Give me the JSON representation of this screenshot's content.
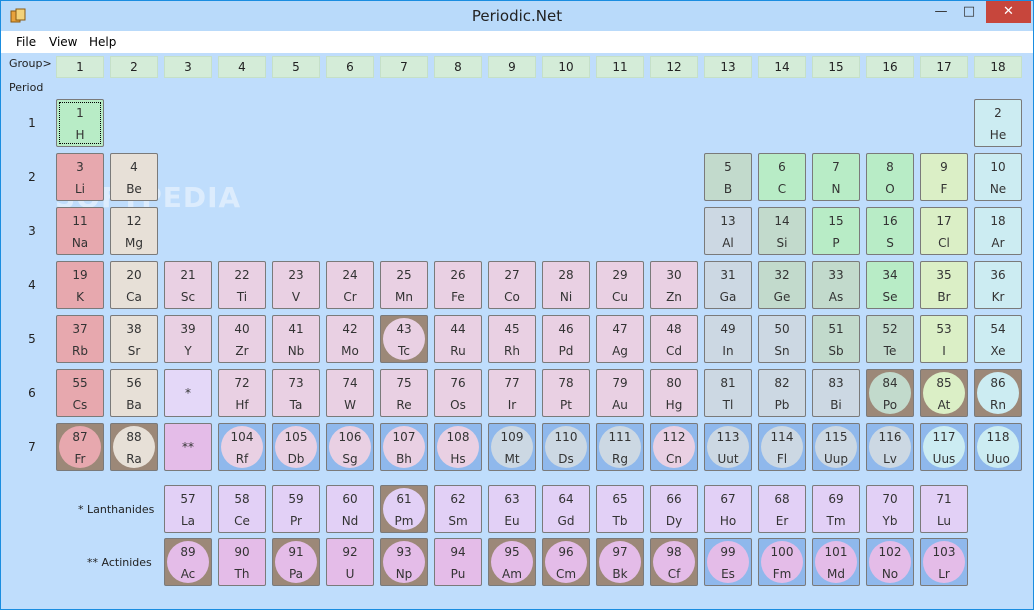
{
  "window": {
    "title": "Periodic.Net",
    "minimize": "—",
    "maximize": "□",
    "close": "✕"
  },
  "menu": [
    "File",
    "View",
    "Help"
  ],
  "labels": {
    "group": "Group>",
    "period": "Period",
    "lanthanides": "* Lanthanides",
    "actinides": "** Actinides"
  },
  "watermark": "SOFTPEDIA",
  "groups": [
    "1",
    "2",
    "3",
    "4",
    "5",
    "6",
    "7",
    "8",
    "9",
    "10",
    "11",
    "12",
    "13",
    "14",
    "15",
    "16",
    "17",
    "18"
  ],
  "periods": [
    "1",
    "2",
    "3",
    "4",
    "5",
    "6",
    "7"
  ],
  "elements": [
    {
      "n": "1",
      "s": "H",
      "g": 1,
      "p": 1,
      "c": "non",
      "sel": true
    },
    {
      "n": "2",
      "s": "He",
      "g": 18,
      "p": 1,
      "c": "nob"
    },
    {
      "n": "3",
      "s": "Li",
      "g": 1,
      "p": 2,
      "c": "alk"
    },
    {
      "n": "4",
      "s": "Be",
      "g": 2,
      "p": 2,
      "c": "ae"
    },
    {
      "n": "5",
      "s": "B",
      "g": 13,
      "p": 2,
      "c": "met"
    },
    {
      "n": "6",
      "s": "C",
      "g": 14,
      "p": 2,
      "c": "non"
    },
    {
      "n": "7",
      "s": "N",
      "g": 15,
      "p": 2,
      "c": "non"
    },
    {
      "n": "8",
      "s": "O",
      "g": 16,
      "p": 2,
      "c": "non"
    },
    {
      "n": "9",
      "s": "F",
      "g": 17,
      "p": 2,
      "c": "hal"
    },
    {
      "n": "10",
      "s": "Ne",
      "g": 18,
      "p": 2,
      "c": "nob"
    },
    {
      "n": "11",
      "s": "Na",
      "g": 1,
      "p": 3,
      "c": "alk"
    },
    {
      "n": "12",
      "s": "Mg",
      "g": 2,
      "p": 3,
      "c": "ae"
    },
    {
      "n": "13",
      "s": "Al",
      "g": 13,
      "p": 3,
      "c": "pt"
    },
    {
      "n": "14",
      "s": "Si",
      "g": 14,
      "p": 3,
      "c": "met"
    },
    {
      "n": "15",
      "s": "P",
      "g": 15,
      "p": 3,
      "c": "non"
    },
    {
      "n": "16",
      "s": "S",
      "g": 16,
      "p": 3,
      "c": "non"
    },
    {
      "n": "17",
      "s": "Cl",
      "g": 17,
      "p": 3,
      "c": "hal"
    },
    {
      "n": "18",
      "s": "Ar",
      "g": 18,
      "p": 3,
      "c": "nob"
    },
    {
      "n": "19",
      "s": "K",
      "g": 1,
      "p": 4,
      "c": "alk"
    },
    {
      "n": "20",
      "s": "Ca",
      "g": 2,
      "p": 4,
      "c": "ae"
    },
    {
      "n": "21",
      "s": "Sc",
      "g": 3,
      "p": 4,
      "c": "tm"
    },
    {
      "n": "22",
      "s": "Ti",
      "g": 4,
      "p": 4,
      "c": "tm"
    },
    {
      "n": "23",
      "s": "V",
      "g": 5,
      "p": 4,
      "c": "tm"
    },
    {
      "n": "24",
      "s": "Cr",
      "g": 6,
      "p": 4,
      "c": "tm"
    },
    {
      "n": "25",
      "s": "Mn",
      "g": 7,
      "p": 4,
      "c": "tm"
    },
    {
      "n": "26",
      "s": "Fe",
      "g": 8,
      "p": 4,
      "c": "tm"
    },
    {
      "n": "27",
      "s": "Co",
      "g": 9,
      "p": 4,
      "c": "tm"
    },
    {
      "n": "28",
      "s": "Ni",
      "g": 10,
      "p": 4,
      "c": "tm"
    },
    {
      "n": "29",
      "s": "Cu",
      "g": 11,
      "p": 4,
      "c": "tm"
    },
    {
      "n": "30",
      "s": "Zn",
      "g": 12,
      "p": 4,
      "c": "tm"
    },
    {
      "n": "31",
      "s": "Ga",
      "g": 13,
      "p": 4,
      "c": "pt"
    },
    {
      "n": "32",
      "s": "Ge",
      "g": 14,
      "p": 4,
      "c": "met"
    },
    {
      "n": "33",
      "s": "As",
      "g": 15,
      "p": 4,
      "c": "met"
    },
    {
      "n": "34",
      "s": "Se",
      "g": 16,
      "p": 4,
      "c": "non"
    },
    {
      "n": "35",
      "s": "Br",
      "g": 17,
      "p": 4,
      "c": "hal"
    },
    {
      "n": "36",
      "s": "Kr",
      "g": 18,
      "p": 4,
      "c": "nob"
    },
    {
      "n": "37",
      "s": "Rb",
      "g": 1,
      "p": 5,
      "c": "alk"
    },
    {
      "n": "38",
      "s": "Sr",
      "g": 2,
      "p": 5,
      "c": "ae"
    },
    {
      "n": "39",
      "s": "Y",
      "g": 3,
      "p": 5,
      "c": "tm"
    },
    {
      "n": "40",
      "s": "Zr",
      "g": 4,
      "p": 5,
      "c": "tm"
    },
    {
      "n": "41",
      "s": "Nb",
      "g": 5,
      "p": 5,
      "c": "tm"
    },
    {
      "n": "42",
      "s": "Mo",
      "g": 6,
      "p": 5,
      "c": "tm"
    },
    {
      "n": "43",
      "s": "Tc",
      "g": 7,
      "p": 5,
      "c": "tm",
      "r": "rad"
    },
    {
      "n": "44",
      "s": "Ru",
      "g": 8,
      "p": 5,
      "c": "tm"
    },
    {
      "n": "45",
      "s": "Rh",
      "g": 9,
      "p": 5,
      "c": "tm"
    },
    {
      "n": "46",
      "s": "Pd",
      "g": 10,
      "p": 5,
      "c": "tm"
    },
    {
      "n": "47",
      "s": "Ag",
      "g": 11,
      "p": 5,
      "c": "tm"
    },
    {
      "n": "48",
      "s": "Cd",
      "g": 12,
      "p": 5,
      "c": "tm"
    },
    {
      "n": "49",
      "s": "In",
      "g": 13,
      "p": 5,
      "c": "pt"
    },
    {
      "n": "50",
      "s": "Sn",
      "g": 14,
      "p": 5,
      "c": "pt"
    },
    {
      "n": "51",
      "s": "Sb",
      "g": 15,
      "p": 5,
      "c": "met"
    },
    {
      "n": "52",
      "s": "Te",
      "g": 16,
      "p": 5,
      "c": "met"
    },
    {
      "n": "53",
      "s": "I",
      "g": 17,
      "p": 5,
      "c": "hal"
    },
    {
      "n": "54",
      "s": "Xe",
      "g": 18,
      "p": 5,
      "c": "nob"
    },
    {
      "n": "55",
      "s": "Cs",
      "g": 1,
      "p": 6,
      "c": "alk"
    },
    {
      "n": "56",
      "s": "Ba",
      "g": 2,
      "p": 6,
      "c": "ae"
    },
    {
      "n": "*",
      "s": "",
      "g": 3,
      "p": 6,
      "c": "ph1",
      "ph": true
    },
    {
      "n": "72",
      "s": "Hf",
      "g": 4,
      "p": 6,
      "c": "tm"
    },
    {
      "n": "73",
      "s": "Ta",
      "g": 5,
      "p": 6,
      "c": "tm"
    },
    {
      "n": "74",
      "s": "W",
      "g": 6,
      "p": 6,
      "c": "tm"
    },
    {
      "n": "75",
      "s": "Re",
      "g": 7,
      "p": 6,
      "c": "tm"
    },
    {
      "n": "76",
      "s": "Os",
      "g": 8,
      "p": 6,
      "c": "tm"
    },
    {
      "n": "77",
      "s": "Ir",
      "g": 9,
      "p": 6,
      "c": "tm"
    },
    {
      "n": "78",
      "s": "Pt",
      "g": 10,
      "p": 6,
      "c": "tm"
    },
    {
      "n": "79",
      "s": "Au",
      "g": 11,
      "p": 6,
      "c": "tm"
    },
    {
      "n": "80",
      "s": "Hg",
      "g": 12,
      "p": 6,
      "c": "tm"
    },
    {
      "n": "81",
      "s": "Tl",
      "g": 13,
      "p": 6,
      "c": "pt"
    },
    {
      "n": "82",
      "s": "Pb",
      "g": 14,
      "p": 6,
      "c": "pt"
    },
    {
      "n": "83",
      "s": "Bi",
      "g": 15,
      "p": 6,
      "c": "pt"
    },
    {
      "n": "84",
      "s": "Po",
      "g": 16,
      "p": 6,
      "c": "met",
      "r": "rad"
    },
    {
      "n": "85",
      "s": "At",
      "g": 17,
      "p": 6,
      "c": "hal",
      "r": "rad"
    },
    {
      "n": "86",
      "s": "Rn",
      "g": 18,
      "p": 6,
      "c": "nob",
      "r": "rad"
    },
    {
      "n": "87",
      "s": "Fr",
      "g": 1,
      "p": 7,
      "c": "alk",
      "r": "rad"
    },
    {
      "n": "88",
      "s": "Ra",
      "g": 2,
      "p": 7,
      "c": "ae",
      "r": "rad"
    },
    {
      "n": "**",
      "s": "",
      "g": 3,
      "p": 7,
      "c": "ph2",
      "ph": true
    },
    {
      "n": "104",
      "s": "Rf",
      "g": 4,
      "p": 7,
      "c": "tm",
      "r": "unk"
    },
    {
      "n": "105",
      "s": "Db",
      "g": 5,
      "p": 7,
      "c": "tm",
      "r": "unk"
    },
    {
      "n": "106",
      "s": "Sg",
      "g": 6,
      "p": 7,
      "c": "tm",
      "r": "unk"
    },
    {
      "n": "107",
      "s": "Bh",
      "g": 7,
      "p": 7,
      "c": "tm",
      "r": "unk"
    },
    {
      "n": "108",
      "s": "Hs",
      "g": 8,
      "p": 7,
      "c": "tm",
      "r": "unk"
    },
    {
      "n": "109",
      "s": "Mt",
      "g": 9,
      "p": 7,
      "c": "pt",
      "r": "unk"
    },
    {
      "n": "110",
      "s": "Ds",
      "g": 10,
      "p": 7,
      "c": "pt",
      "r": "unk"
    },
    {
      "n": "111",
      "s": "Rg",
      "g": 11,
      "p": 7,
      "c": "pt",
      "r": "unk"
    },
    {
      "n": "112",
      "s": "Cn",
      "g": 12,
      "p": 7,
      "c": "tm",
      "r": "unk"
    },
    {
      "n": "113",
      "s": "Uut",
      "g": 13,
      "p": 7,
      "c": "pt",
      "r": "unk"
    },
    {
      "n": "114",
      "s": "Fl",
      "g": 14,
      "p": 7,
      "c": "pt",
      "r": "unk"
    },
    {
      "n": "115",
      "s": "Uup",
      "g": 15,
      "p": 7,
      "c": "pt",
      "r": "unk"
    },
    {
      "n": "116",
      "s": "Lv",
      "g": 16,
      "p": 7,
      "c": "pt",
      "r": "unk"
    },
    {
      "n": "117",
      "s": "Uus",
      "g": 17,
      "p": 7,
      "c": "nob",
      "r": "unk"
    },
    {
      "n": "118",
      "s": "Uuo",
      "g": 18,
      "p": 7,
      "c": "nob",
      "r": "unk"
    },
    {
      "n": "57",
      "s": "La",
      "g": 3,
      "p": 8,
      "c": "lan"
    },
    {
      "n": "58",
      "s": "Ce",
      "g": 4,
      "p": 8,
      "c": "lan"
    },
    {
      "n": "59",
      "s": "Pr",
      "g": 5,
      "p": 8,
      "c": "lan"
    },
    {
      "n": "60",
      "s": "Nd",
      "g": 6,
      "p": 8,
      "c": "lan"
    },
    {
      "n": "61",
      "s": "Pm",
      "g": 7,
      "p": 8,
      "c": "lan",
      "r": "rad"
    },
    {
      "n": "62",
      "s": "Sm",
      "g": 8,
      "p": 8,
      "c": "lan"
    },
    {
      "n": "63",
      "s": "Eu",
      "g": 9,
      "p": 8,
      "c": "lan"
    },
    {
      "n": "64",
      "s": "Gd",
      "g": 10,
      "p": 8,
      "c": "lan"
    },
    {
      "n": "65",
      "s": "Tb",
      "g": 11,
      "p": 8,
      "c": "lan"
    },
    {
      "n": "66",
      "s": "Dy",
      "g": 12,
      "p": 8,
      "c": "lan"
    },
    {
      "n": "67",
      "s": "Ho",
      "g": 13,
      "p": 8,
      "c": "lan"
    },
    {
      "n": "68",
      "s": "Er",
      "g": 14,
      "p": 8,
      "c": "lan"
    },
    {
      "n": "69",
      "s": "Tm",
      "g": 15,
      "p": 8,
      "c": "lan"
    },
    {
      "n": "70",
      "s": "Yb",
      "g": 16,
      "p": 8,
      "c": "lan"
    },
    {
      "n": "71",
      "s": "Lu",
      "g": 17,
      "p": 8,
      "c": "lan"
    },
    {
      "n": "89",
      "s": "Ac",
      "g": 3,
      "p": 9,
      "c": "act",
      "r": "rad"
    },
    {
      "n": "90",
      "s": "Th",
      "g": 4,
      "p": 9,
      "c": "act"
    },
    {
      "n": "91",
      "s": "Pa",
      "g": 5,
      "p": 9,
      "c": "act",
      "r": "rad"
    },
    {
      "n": "92",
      "s": "U",
      "g": 6,
      "p": 9,
      "c": "act"
    },
    {
      "n": "93",
      "s": "Np",
      "g": 7,
      "p": 9,
      "c": "act",
      "r": "rad"
    },
    {
      "n": "94",
      "s": "Pu",
      "g": 8,
      "p": 9,
      "c": "act"
    },
    {
      "n": "95",
      "s": "Am",
      "g": 9,
      "p": 9,
      "c": "act",
      "r": "rad"
    },
    {
      "n": "96",
      "s": "Cm",
      "g": 10,
      "p": 9,
      "c": "act",
      "r": "rad"
    },
    {
      "n": "97",
      "s": "Bk",
      "g": 11,
      "p": 9,
      "c": "act",
      "r": "rad"
    },
    {
      "n": "98",
      "s": "Cf",
      "g": 12,
      "p": 9,
      "c": "act",
      "r": "rad"
    },
    {
      "n": "99",
      "s": "Es",
      "g": 13,
      "p": 9,
      "c": "act",
      "r": "unk"
    },
    {
      "n": "100",
      "s": "Fm",
      "g": 14,
      "p": 9,
      "c": "act",
      "r": "unk"
    },
    {
      "n": "101",
      "s": "Md",
      "g": 15,
      "p": 9,
      "c": "act",
      "r": "unk"
    },
    {
      "n": "102",
      "s": "No",
      "g": 16,
      "p": 9,
      "c": "act",
      "r": "unk"
    },
    {
      "n": "103",
      "s": "Lr",
      "g": 17,
      "p": 9,
      "c": "act",
      "r": "unk"
    }
  ]
}
